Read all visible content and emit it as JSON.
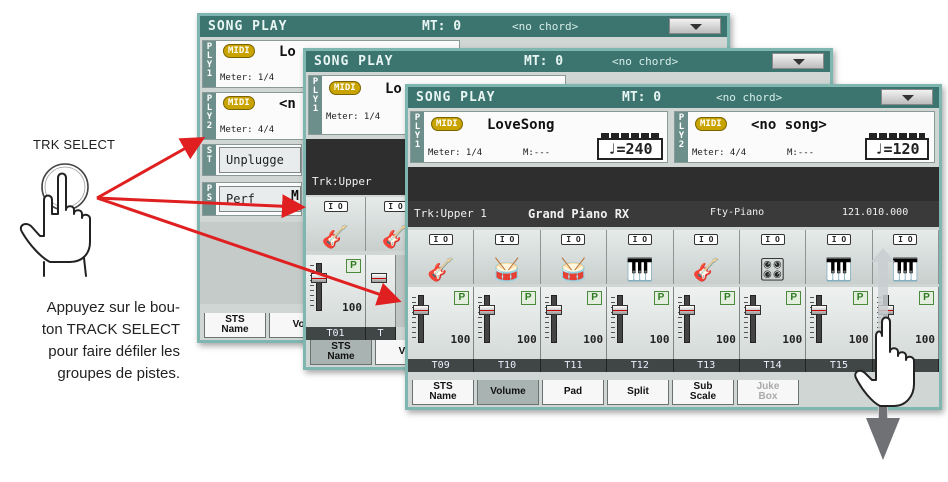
{
  "left_panel": {
    "button_label": "TRK SELECT",
    "instruction_lines": [
      "Appuyez sur le bou-",
      "ton TRACK SELECT",
      "pour faire défiler les",
      "groupes de pistes."
    ]
  },
  "icons": {
    "finger": "pointing-hand-icon",
    "arrow": "red-arrow-icon",
    "scroll": "down-arrow-icon"
  },
  "colors": {
    "arrow_red": "#e02020",
    "titlebar": "#3c7570",
    "midi_badge": "#c9a400"
  },
  "screen_back": {
    "title": "SONG PLAY",
    "mt": "MT: 0",
    "chord": "<no chord>",
    "player1_tab": "P L Y 1",
    "player1_song": "Lo",
    "player1_meter": "Meter: 1/4",
    "player2_tab": "P L Y 2",
    "player2_song": "<n",
    "player2_meter": "Meter: 4/4",
    "st_tab": "S T",
    "st_value": "Unplugge",
    "perf_tab": "P S",
    "perf_value": "Perf",
    "perf_extra": "M",
    "tab1": "STS\nName",
    "tab2": "Vol",
    "midi": "MIDI"
  },
  "screen_mid": {
    "title": "SONG PLAY",
    "mt": "MT: 0",
    "chord": "<no chord>",
    "player1_tab": "P L Y 1",
    "player1_song": "Lo",
    "player1_meter": "Meter: 1/4",
    "track_label": "Trk:Upper",
    "track_code": "T01",
    "track_code2": "T",
    "fader_value": "100",
    "tab1": "STS\nName",
    "tab2": "Vol",
    "midi": "MIDI"
  },
  "screen_front": {
    "title": "SONG PLAY",
    "mt": "MT: 0",
    "chord": "<no chord>",
    "player1": {
      "tab": "P L Y 1",
      "midi": "MIDI",
      "song": "LoveSong",
      "meter": "Meter: 1/4",
      "measure": "M:---",
      "tempo": "♩=240"
    },
    "player2": {
      "tab": "P L Y 2",
      "midi": "MIDI",
      "song": "<no song>",
      "meter": "Meter: 4/4",
      "measure": "M:---",
      "tempo": "♩=120"
    },
    "track_info": {
      "track": "Trk:Upper 1",
      "sound": "Grand Piano RX",
      "bank": "Fty-Piano",
      "program": "121.010.000"
    },
    "instruments": [
      "guitar",
      "drums",
      "drums",
      "piano",
      "guitar",
      "keyboard",
      "organ",
      "piano"
    ],
    "io_label": "I O",
    "faders": [
      {
        "track": "T09",
        "value": "100"
      },
      {
        "track": "T10",
        "value": "100"
      },
      {
        "track": "T11",
        "value": "100"
      },
      {
        "track": "T12",
        "value": "100"
      },
      {
        "track": "T13",
        "value": "100"
      },
      {
        "track": "T14",
        "value": "100"
      },
      {
        "track": "T15",
        "value": "100"
      },
      {
        "track": "T16",
        "value": "100"
      }
    ],
    "play_button": "P",
    "tabs": [
      {
        "label": "STS\nName",
        "state": "normal"
      },
      {
        "label": "Volume",
        "state": "selected"
      },
      {
        "label": "Pad",
        "state": "normal"
      },
      {
        "label": "Split",
        "state": "normal"
      },
      {
        "label": "Sub\nScale",
        "state": "normal"
      },
      {
        "label": "Juke\nBox",
        "state": "disabled"
      }
    ]
  }
}
